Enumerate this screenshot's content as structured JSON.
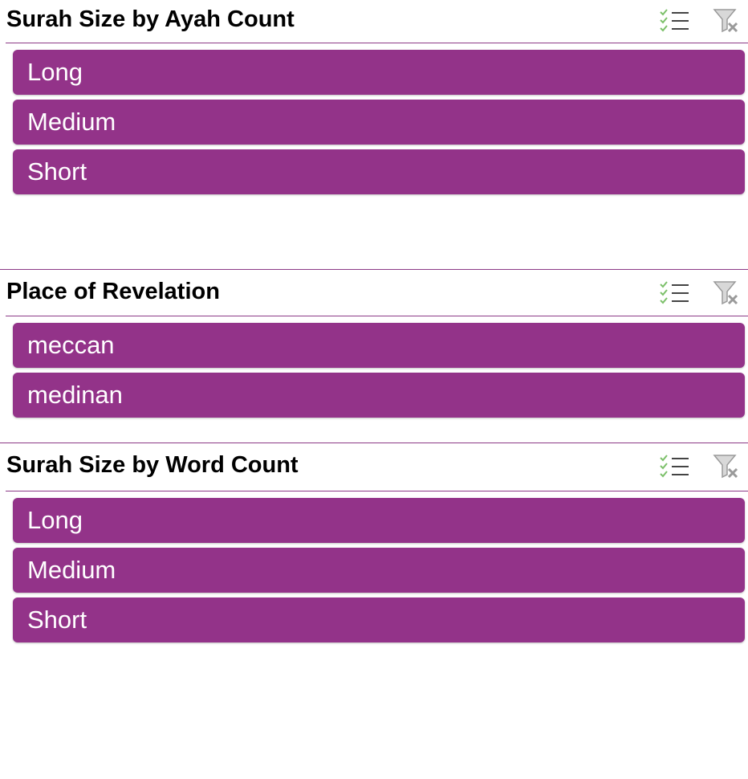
{
  "slicers": [
    {
      "title": "Surah Size by Ayah Count",
      "items": [
        {
          "label": "Long"
        },
        {
          "label": "Medium"
        },
        {
          "label": "Short"
        }
      ]
    },
    {
      "title": "Place of Revelation",
      "items": [
        {
          "label": "meccan"
        },
        {
          "label": "medinan"
        }
      ]
    },
    {
      "title": "Surah Size by Word Count",
      "items": [
        {
          "label": "Long"
        },
        {
          "label": "Medium"
        },
        {
          "label": "Short"
        }
      ]
    }
  ],
  "icons": {
    "multiselect": "multi-select-icon",
    "clear_filter": "clear-filter-icon"
  },
  "colors": {
    "item_fill": "#933389",
    "item_text": "#ffffff",
    "rule": "#8c3a87",
    "check_green": "#7cc06a"
  }
}
